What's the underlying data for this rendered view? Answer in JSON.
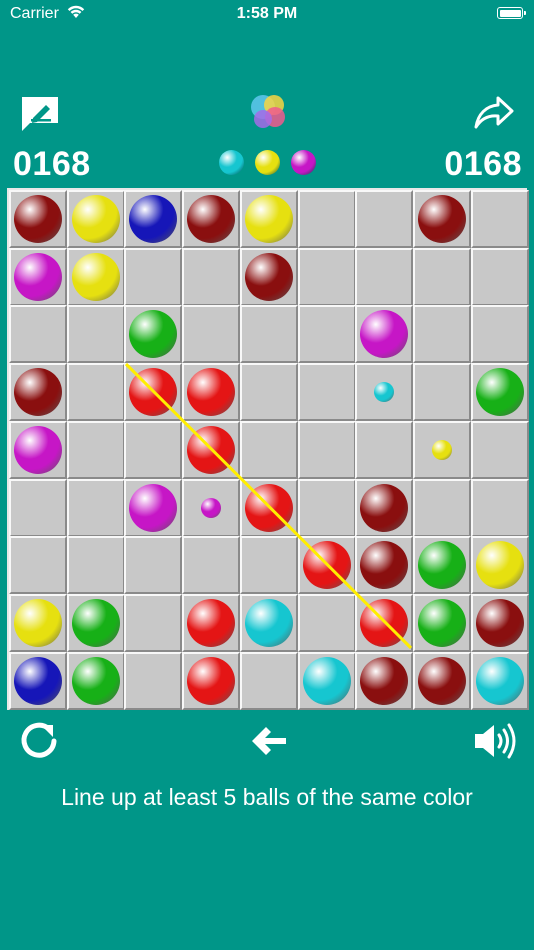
{
  "status_bar": {
    "carrier": "Carrier",
    "time": "1:58 PM"
  },
  "header": {
    "score_left": "0168",
    "score_right": "0168",
    "next_balls": [
      "cyan",
      "yellow",
      "magenta"
    ]
  },
  "board": {
    "rows": 9,
    "cols": 9,
    "cells": [
      [
        "darkred",
        "yellow",
        "blue",
        "darkred",
        "yellow",
        "",
        "",
        "darkred",
        ""
      ],
      [
        "magenta",
        "yellow",
        "",
        "",
        "darkred",
        "",
        "",
        "",
        ""
      ],
      [
        "",
        "",
        "green",
        "",
        "",
        "",
        "magenta",
        "",
        ""
      ],
      [
        "darkred",
        "",
        "red",
        "red",
        "",
        "",
        "cyan-small",
        "",
        "green"
      ],
      [
        "magenta",
        "",
        "",
        "red",
        "",
        "",
        "",
        "yellow-small",
        ""
      ],
      [
        "",
        "",
        "magenta",
        "magenta-small",
        "red",
        "",
        "darkred",
        "",
        ""
      ],
      [
        "",
        "",
        "",
        "",
        "",
        "red",
        "darkred",
        "green",
        "yellow"
      ],
      [
        "yellow",
        "green",
        "",
        "red",
        "cyan",
        "",
        "red",
        "green",
        "darkred"
      ],
      [
        "blue",
        "green",
        "",
        "red",
        "",
        "cyan",
        "darkred",
        "darkred",
        "cyan"
      ]
    ]
  },
  "colors": {
    "red": "#e41515",
    "darkred": "#8a0f0f",
    "yellow": "#e6e010",
    "green": "#17b017",
    "blue": "#1616b8",
    "magenta": "#c616c6",
    "cyan": "#16c6d0",
    "background": "#009688",
    "path_line": "#ffee00"
  },
  "icons": {
    "top_left": "edit-note-icon",
    "top_center": "game-center-icon",
    "top_right": "share-icon",
    "bottom_left": "restart-icon",
    "bottom_center": "undo-icon",
    "bottom_right": "sound-icon"
  },
  "footer": {
    "hint": "Line up at least 5 balls of the same color"
  }
}
